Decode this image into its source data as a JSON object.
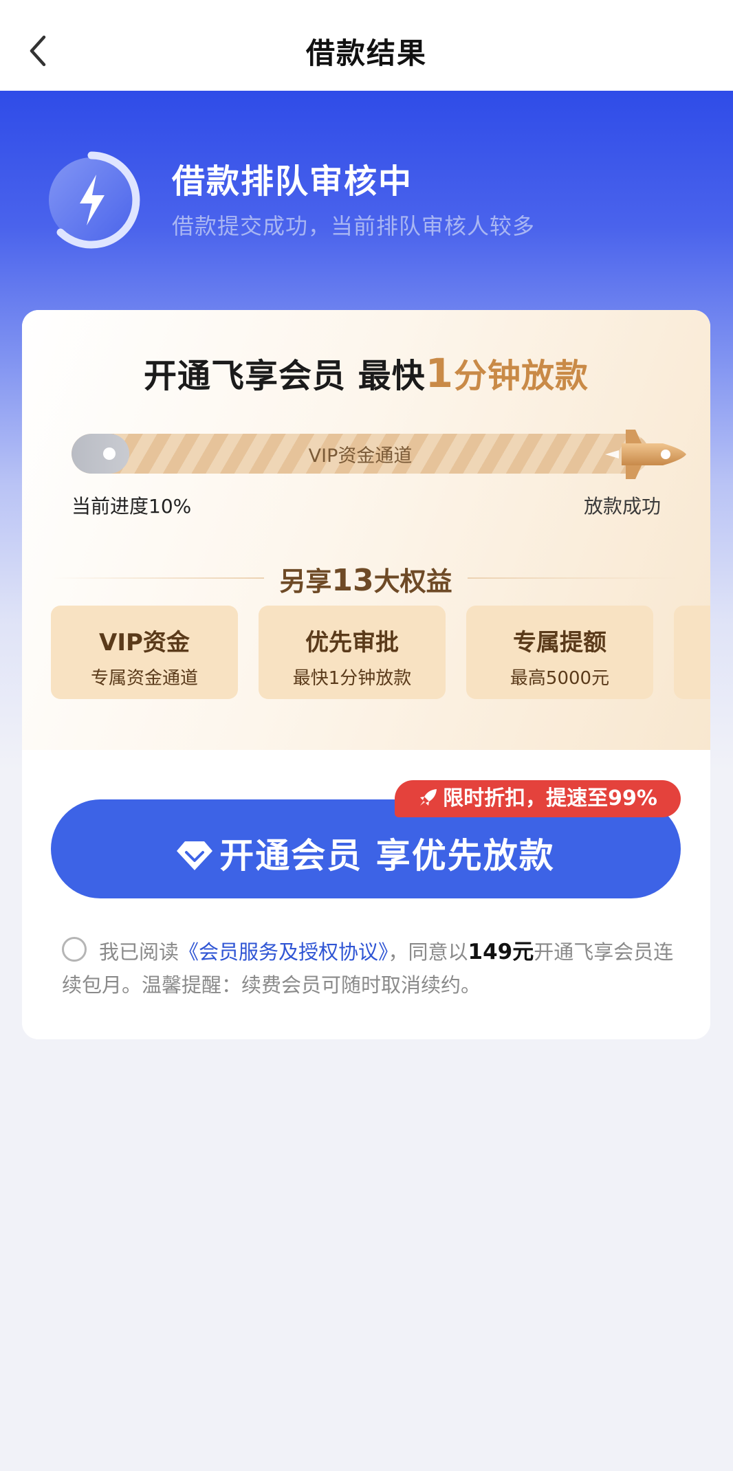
{
  "nav": {
    "title": "借款结果",
    "back_icon": "chevron-left-icon"
  },
  "status": {
    "icon": "lightning-icon",
    "title": "借款排队审核中",
    "subtitle": "借款提交成功，当前排队审核人较多"
  },
  "promo": {
    "title_prefix": "开通飞享会员 最快",
    "title_number": "1",
    "title_suffix": "分钟放款",
    "accent_color": "#c98a47"
  },
  "progress": {
    "channel_label": "VIP资金通道",
    "current_label": "当前进度10%",
    "end_label": "放款成功",
    "value": 0.1
  },
  "benefits": {
    "header_prefix": "另享",
    "header_number": "13",
    "header_suffix": "大权益",
    "items": [
      {
        "title": "VIP资金",
        "subtitle": "专属资金通道"
      },
      {
        "title": "优先审批",
        "subtitle": "最快1分钟放款"
      },
      {
        "title": "专属提额",
        "subtitle": "最高5000元"
      },
      {
        "title": "",
        "subtitle": ""
      }
    ]
  },
  "cta": {
    "label": "开通会员 享优先放款",
    "icon": "diamond-icon",
    "color": "#3d63e6",
    "badge": "限时折扣，提速至99%",
    "badge_icon": "rocket-icon",
    "badge_color": "#e4423c"
  },
  "agreement": {
    "prefix": "我已阅读",
    "link": "《会员服务及授权协议》",
    "middle": "，同意以",
    "price": "149元",
    "suffix": "开通飞享会员连续包月。温馨提醒：续费会员可随时取消续约。",
    "checked": false
  }
}
